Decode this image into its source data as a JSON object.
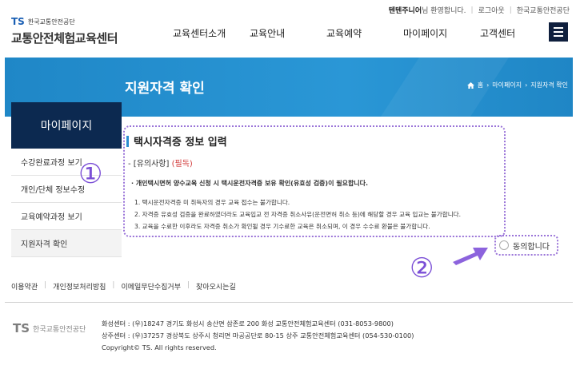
{
  "utility": {
    "welcome_user": "텐텐주니어",
    "welcome_msg": "님 환영합니다.",
    "logout": "로그아웃",
    "org_link": "한국교통안전공단"
  },
  "header": {
    "logo_ts": "TS",
    "logo_org": "한국교통안전공단",
    "center_name": "교통안전체험교육센터",
    "nav": [
      "교육센터소개",
      "교육안내",
      "교육예약",
      "마이페이지",
      "고객센터"
    ]
  },
  "banner": {
    "title": "지원자격 확인",
    "breadcrumb": [
      "홈",
      "마이페이지",
      "지원자격 확인"
    ]
  },
  "sidebar": {
    "title": "마이페이지",
    "items": [
      "수강완료과정 보기",
      "개인/단체 정보수정",
      "교육예약과정 보기",
      "지원자격 확인"
    ]
  },
  "main": {
    "section_title": "택시자격증 정보 입력",
    "notice_head": "[유의사항]",
    "notice_required": "(필독)",
    "notice_intro": "개인택시면허 양수교육 신청 시 택시운전자격증 보유 확인(유효성 검증)이 필요합니다.",
    "notice_items": [
      "1. 택시운전자격증 미 취득자의 경우 교육 접수는 불가합니다.",
      "2. 자격증 유효성 검증을 완료하였더라도 교육입교 전 자격증 취소사유(운전면허 취소 등)에 해당할 경우 교육 입교는 불가합니다.",
      "3. 교육을 수료한 이후라도 자격증 취소가 확인될 경우 기수료한 교육은 취소되며, 이 경우 수수료 환불은 불가합니다."
    ],
    "agree_label": "동의합니다"
  },
  "annotations": {
    "marker1": "①",
    "marker2": "②"
  },
  "footer": {
    "links": [
      "이용약관",
      "개인정보처리방침",
      "이메일무단수집거부",
      "찾아오시는길"
    ],
    "logo_ts": "TS",
    "logo_org": "한국교통안전공단",
    "info": [
      "화성센터 : (우)18247 경기도 화성시 송산면 삼존로 200 화성 교통안전체험교육센터 (031-8053-9800)",
      "상주센터 : (우)37257 경상북도 상주시 청리면 마공공단로 80-15 상주 교통안전체험교육센터 (054-530-0100)",
      "Copyright© TS. All rights reserved."
    ]
  },
  "colors": {
    "banner_blue": "#2a97d6",
    "sidebar_navy": "#0c2950",
    "annotation_purple": "#9a74d8",
    "required_red": "#d23a3a"
  }
}
